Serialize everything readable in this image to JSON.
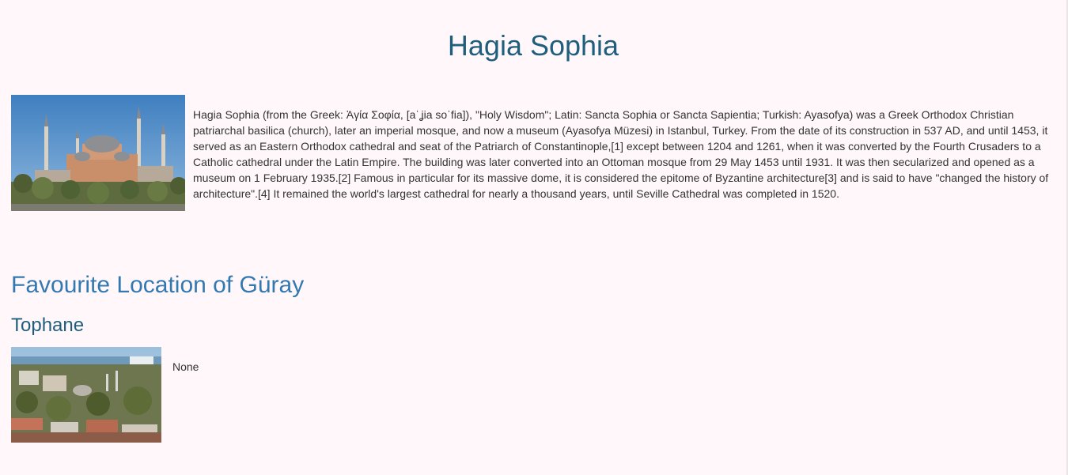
{
  "page": {
    "title": "Hagia Sophia"
  },
  "main": {
    "image_subject": "Hagia Sophia photo",
    "description": " Hagia Sophia (from the Greek: Ἁγία Σοφία, [aˈʝia soˈfia]), \"Holy Wisdom\"; Latin: Sancta Sophia or Sancta Sapientia; Turkish: Ayasofya) was a Greek Orthodox Christian patriarchal basilica (church), later an imperial mosque, and now a museum (Ayasofya Müzesi) in Istanbul, Turkey. From the date of its construction in 537 AD, and until 1453, it served as an Eastern Orthodox cathedral and seat of the Patriarch of Constantinople,[1] except between 1204 and 1261, when it was converted by the Fourth Crusaders to a Catholic cathedral under the Latin Empire. The building was later converted into an Ottoman mosque from 29 May 1453 until 1931. It was then secularized and opened as a museum on 1 February 1935.[2] Famous in particular for its massive dome, it is considered the epitome of Byzantine architecture[3] and is said to have \"changed the history of architecture\".[4] It remained the world's largest cathedral for nearly a thousand years, until Seville Cathedral was completed in 1520."
  },
  "favourites": {
    "section_title": "Favourite Location of Güray",
    "location": {
      "name": "Tophane",
      "image_subject": "Tophane photo",
      "description": "None"
    }
  },
  "colors": {
    "background": "#fff7f9",
    "title": "#1f5f7d",
    "section_title": "#3379b1",
    "body_text": "#333333"
  }
}
